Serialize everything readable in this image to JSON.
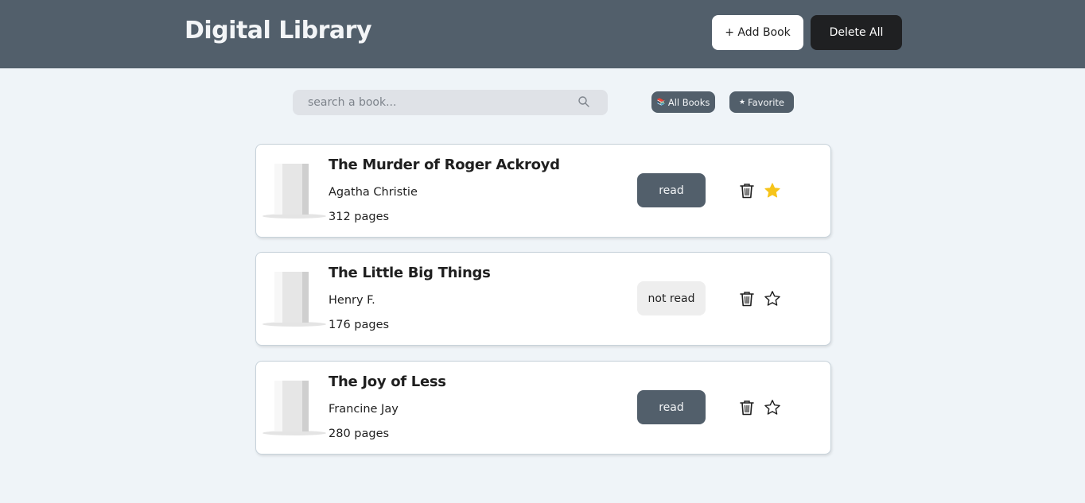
{
  "header": {
    "title": "Digital Library",
    "add_book_label": "+ Add Book",
    "delete_all_label": "Delete All",
    "background": "#525f6b"
  },
  "search": {
    "placeholder": "search a book...",
    "value": "",
    "icon": "search-icon"
  },
  "filters": [
    {
      "label": "All Books",
      "icon": "books-icon",
      "glyph": "📚"
    },
    {
      "label": "Favorite",
      "icon": "star-icon",
      "glyph": "★"
    }
  ],
  "books": [
    {
      "title": "The Murder of Roger Ackroyd",
      "author": "Agatha Christie",
      "pages": "312 pages",
      "status": "read",
      "is_read": true,
      "favorite": true
    },
    {
      "title": "The Little Big Things",
      "author": "Henry F.",
      "pages": "176 pages",
      "status": "not read",
      "is_read": false,
      "favorite": false
    },
    {
      "title": "The Joy of Less",
      "author": "Francine Jay",
      "pages": "280 pages",
      "status": "read",
      "is_read": true,
      "favorite": false
    }
  ],
  "colors": {
    "page_background": "#eff4f8",
    "accent": "#525f6b",
    "dark_button": "#1f2022",
    "favorite_star": "#f6c41a"
  }
}
